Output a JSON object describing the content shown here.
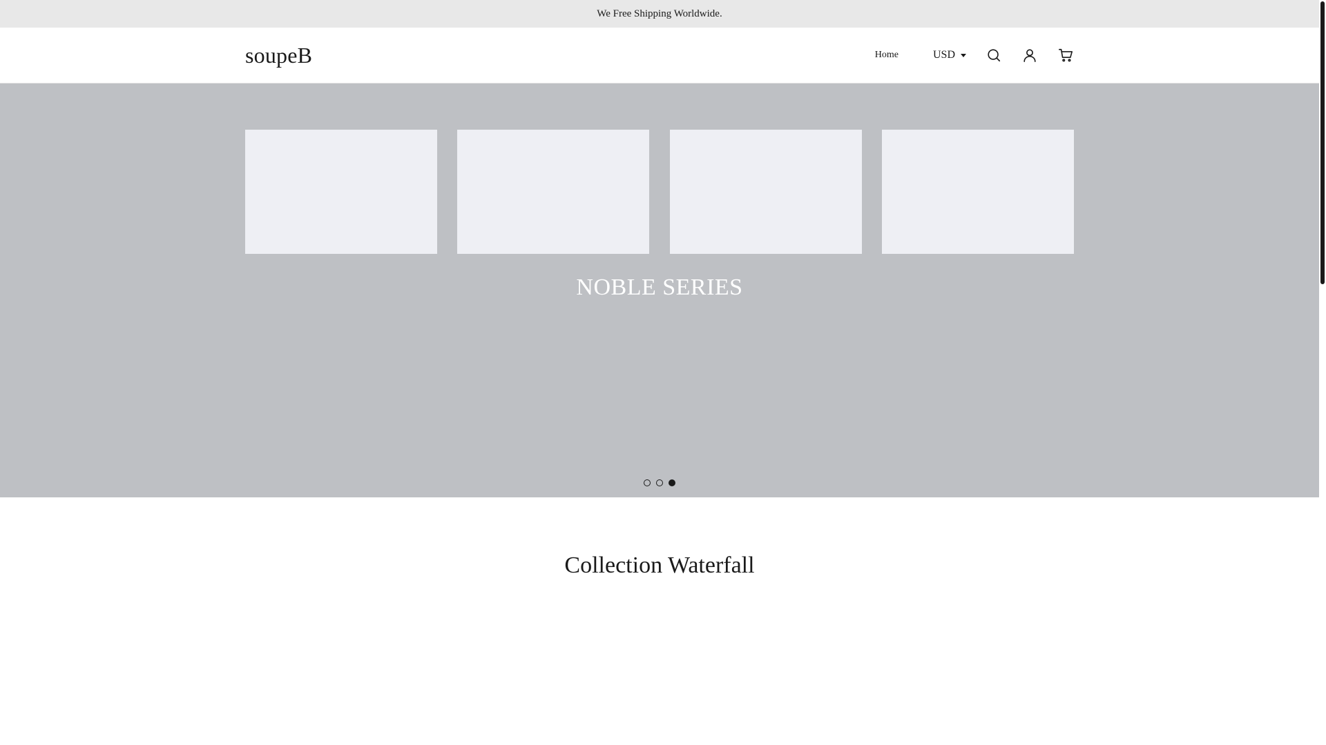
{
  "announcement": "We Free Shipping Worldwide.",
  "header": {
    "logo": "soupeB",
    "nav": [
      {
        "label": "Home"
      }
    ],
    "currency": "USD",
    "icons": [
      "search-icon",
      "user-icon",
      "cart-icon"
    ]
  },
  "hero": {
    "title": "NOBLE SERIES",
    "slides": 3,
    "active_slide": 3,
    "background": "#bec0c4"
  },
  "collection": {
    "title": "Collection Waterfall",
    "cards": 4,
    "card_color": "#eeeff4"
  },
  "colors": {
    "announce_bg": "#e8e8e8",
    "text": "#1a1a1a",
    "hero_text": "#ffffff"
  }
}
